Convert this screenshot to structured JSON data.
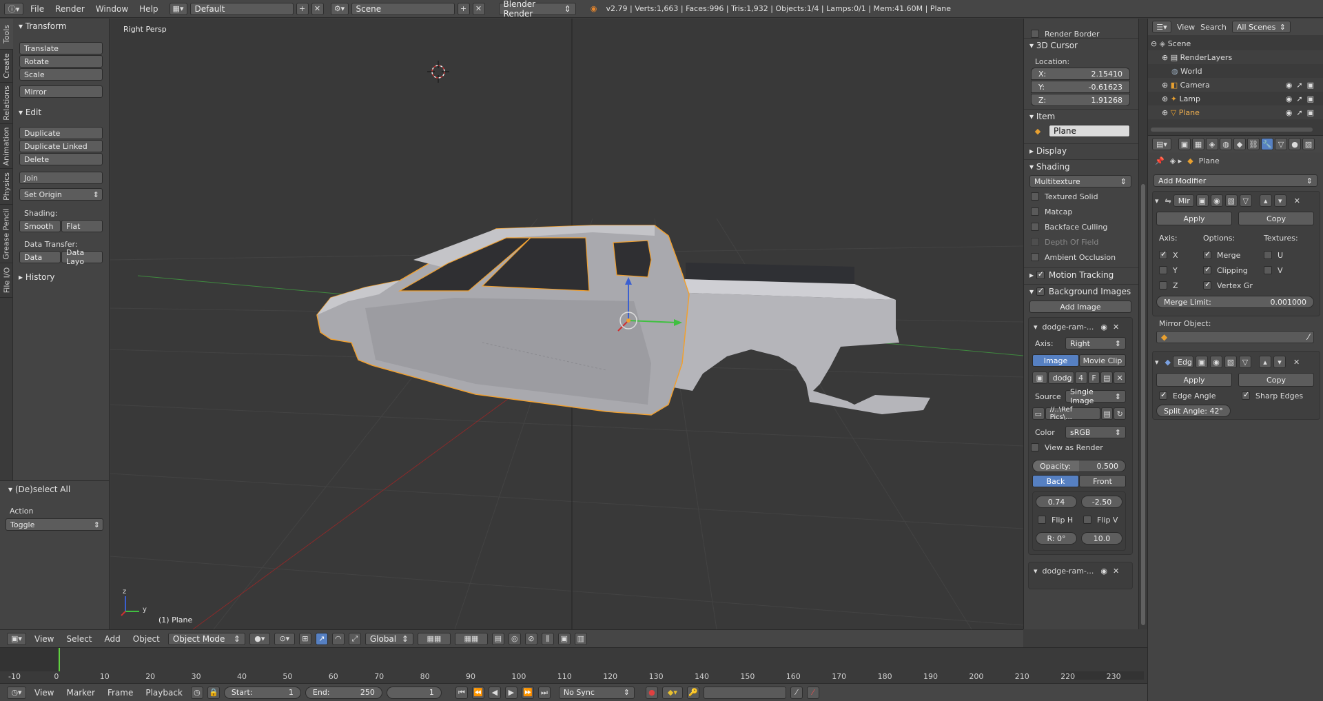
{
  "topbar": {
    "menus": [
      "File",
      "Render",
      "Window",
      "Help"
    ],
    "layout": "Default",
    "scene": "Scene",
    "engine": "Blender Render",
    "stats": "v2.79 | Verts:1,663 | Faces:996 | Tris:1,932 | Objects:1/4 | Lamps:0/1 | Mem:41.60M | Plane"
  },
  "vtabs": [
    "Tools",
    "Create",
    "Relations",
    "Animation",
    "Physics",
    "Grease Pencil",
    "File I/O"
  ],
  "toolshelf": {
    "transform_title": "Transform",
    "translate": "Translate",
    "rotate": "Rotate",
    "scale": "Scale",
    "mirror": "Mirror",
    "edit_title": "Edit",
    "duplicate": "Duplicate",
    "duplicate_linked": "Duplicate Linked",
    "delete": "Delete",
    "join": "Join",
    "set_origin": "Set Origin",
    "shading_label": "Shading:",
    "smooth": "Smooth",
    "flat": "Flat",
    "data_transfer_label": "Data Transfer:",
    "data": "Data",
    "data_layout": "Data Layo",
    "history_title": "History"
  },
  "operator_panel": {
    "title": "(De)select All",
    "action_label": "Action",
    "action_value": "Toggle"
  },
  "viewport": {
    "view_name": "Right Persp",
    "object_label": "(1) Plane",
    "axis_z": "z",
    "axis_y": "y"
  },
  "viewport_header": {
    "menus": [
      "View",
      "Select",
      "Add",
      "Object"
    ],
    "mode": "Object Mode",
    "orientation": "Global"
  },
  "npanel": {
    "render_border": "Render Border",
    "cursor_title": "3D Cursor",
    "location_label": "Location:",
    "x_label": "X:",
    "x_value": "2.15410",
    "y_label": "Y:",
    "y_value": "-0.61623",
    "z_label": "Z:",
    "z_value": "1.91268",
    "item_title": "Item",
    "item_name": "Plane",
    "display_title": "Display",
    "shading_title": "Shading",
    "shading_mode": "Multitexture",
    "textured_solid": "Textured Solid",
    "matcap": "Matcap",
    "backface_culling": "Backface Culling",
    "depth_of_field": "Depth Of Field",
    "ambient_occlusion": "Ambient Occlusion",
    "motion_tracking": "Motion Tracking",
    "background_images": "Background Images",
    "add_image": "Add Image",
    "bg_image_name": "dodge-ram-...",
    "axis_label": "Axis:",
    "axis_value": "Right",
    "tab_image": "Image",
    "tab_movie_clip": "Movie Clip",
    "img_name": "dodg",
    "img_users": "4",
    "img_fake": "F",
    "source_label": "Source",
    "source_value": "Single Image",
    "filepath": "//..\\Ref Pics\\...",
    "color_label": "Color",
    "color_value": "sRGB",
    "view_as_render": "View as Render",
    "opacity_label": "Opacity:",
    "opacity_value": "0.500",
    "back": "Back",
    "front": "Front",
    "offset_x": "0.74",
    "offset_y": "-2.50",
    "flip_h": "Flip H",
    "flip_v": "Flip V",
    "rotation": "R: 0°",
    "size": "10.0",
    "bg_image_name_2": "dodge-ram-..."
  },
  "outliner": {
    "view": "View",
    "search": "Search",
    "filter": "All Scenes",
    "items": [
      "Scene",
      "RenderLayers",
      "World",
      "Camera",
      "Lamp",
      "Plane"
    ]
  },
  "props": {
    "context_object": "Plane",
    "add_modifier": "Add Modifier",
    "mod1_name": "Mir",
    "apply": "Apply",
    "copy": "Copy",
    "axis_label": "Axis:",
    "options_label": "Options:",
    "textures_label": "Textures:",
    "x": "X",
    "y": "Y",
    "z": "Z",
    "merge": "Merge",
    "clipping": "Clipping",
    "vertex_groups": "Vertex Gr",
    "u": "U",
    "v": "V",
    "merge_limit_label": "Merge Limit:",
    "merge_limit_value": "0.001000",
    "mirror_object_label": "Mirror Object:",
    "mod2_name": "Edg",
    "apply2": "Apply",
    "copy2": "Copy",
    "edge_angle": "Edge Angle",
    "sharp_edges": "Sharp Edges",
    "split_angle": "Split Angle: 42°"
  },
  "timeline": {
    "ticks": [
      "-10",
      "0",
      "10",
      "20",
      "30",
      "40",
      "50",
      "60",
      "70",
      "80",
      "90",
      "100",
      "110",
      "120",
      "130",
      "140",
      "150",
      "160",
      "170",
      "180",
      "190",
      "200",
      "210",
      "220",
      "230"
    ],
    "current_frame_position": 0
  },
  "timeline_header": {
    "menus": [
      "View",
      "Marker",
      "Frame",
      "Playback"
    ],
    "start_label": "Start:",
    "start_value": "1",
    "end_label": "End:",
    "end_value": "250",
    "current_frame": "1",
    "sync": "No Sync"
  },
  "colors": {
    "selection_outline": "#f0a030",
    "active_blue": "#5680c2",
    "axis_x": "#c03030",
    "axis_y": "#40b040"
  }
}
